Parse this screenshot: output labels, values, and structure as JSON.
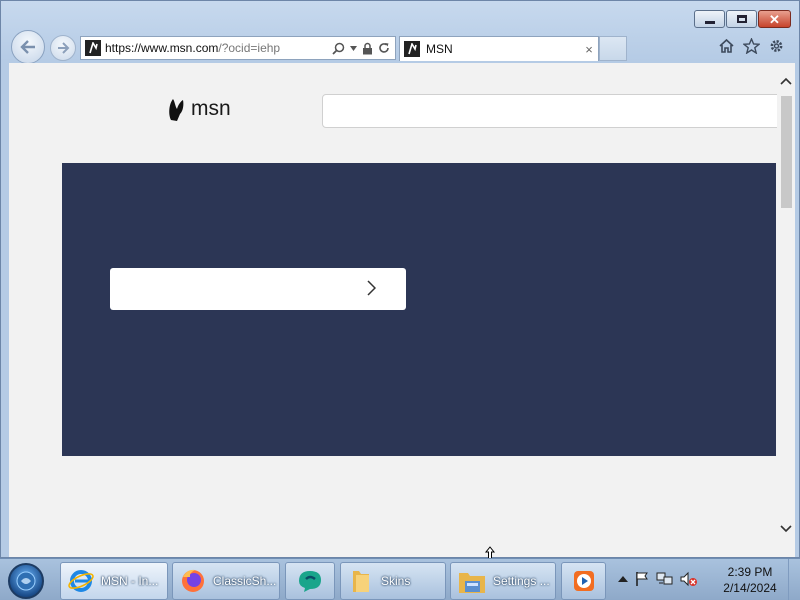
{
  "browser": {
    "address_domain": "https://www.msn.com",
    "address_rest": "/?ocid=iehp",
    "tab_title": "MSN",
    "tab_close": "×"
  },
  "page": {
    "logo_text": "msn",
    "search_value": ""
  },
  "taskbar": {
    "items": [
      {
        "label": "MSN - In...",
        "icon": "internet-explorer-icon"
      },
      {
        "label": "ClassicSh...",
        "icon": "firefox-icon"
      },
      {
        "label": "",
        "icon": "bing-chat-icon"
      },
      {
        "label": "Skins",
        "icon": "folder-icon"
      },
      {
        "label": "Settings ...",
        "icon": "settings-folder-icon"
      },
      {
        "label": "",
        "icon": "media-player-icon"
      }
    ],
    "clock_time": "2:39 PM",
    "clock_date": "2/14/2024"
  },
  "colors": {
    "hero_bg": "#2c3655",
    "page_bg": "#f2f2f2"
  }
}
